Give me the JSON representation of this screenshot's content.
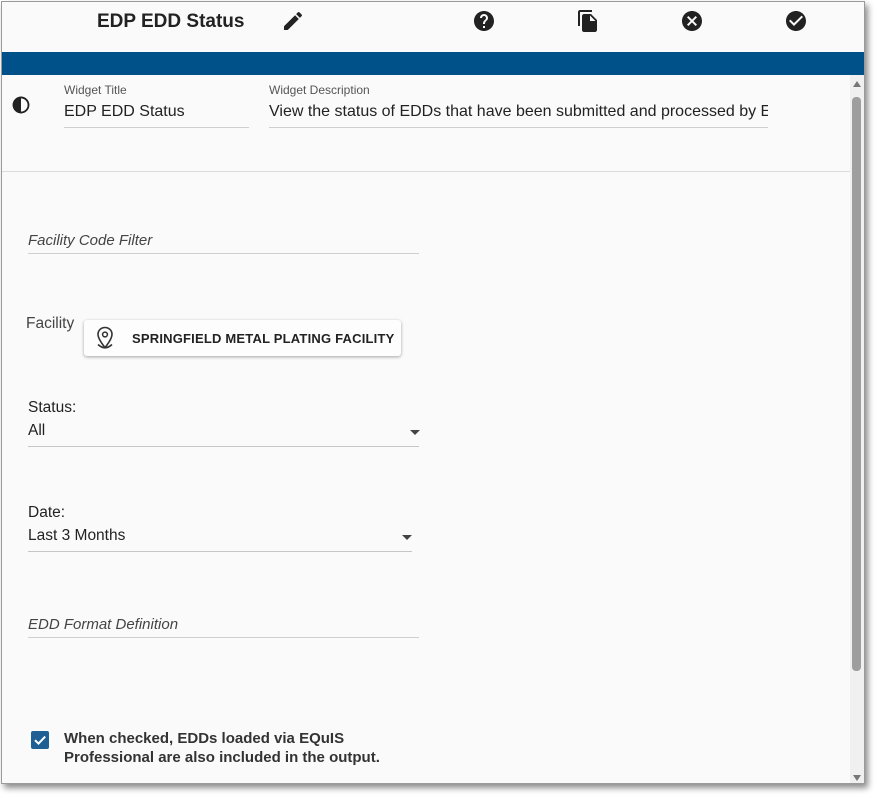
{
  "header": {
    "title": "EDP EDD Status",
    "icons": [
      "pencil-icon",
      "help-icon",
      "copy-icon",
      "close-circle-icon",
      "check-circle-icon"
    ]
  },
  "colors": {
    "accent_bar": "#005189",
    "checkbox": "#1f5f93"
  },
  "widget": {
    "title_label": "Widget Title",
    "title_value": "EDP EDD Status",
    "description_label": "Widget Description",
    "description_value": "View the status of EDDs that have been submitted and processed by E"
  },
  "form": {
    "facility_code_filter_label": "Facility Code Filter",
    "facility_label": "Facility",
    "facility_value": "SPRINGFIELD METAL PLATING FACILITY",
    "status_label": "Status:",
    "status_value": "All",
    "date_label": "Date:",
    "date_value": "Last 3 Months",
    "edd_format_label": "EDD Format Definition",
    "include_equis_checked": true,
    "include_equis_text": "When checked, EDDs loaded via EQuIS Professional are also included in the output."
  }
}
